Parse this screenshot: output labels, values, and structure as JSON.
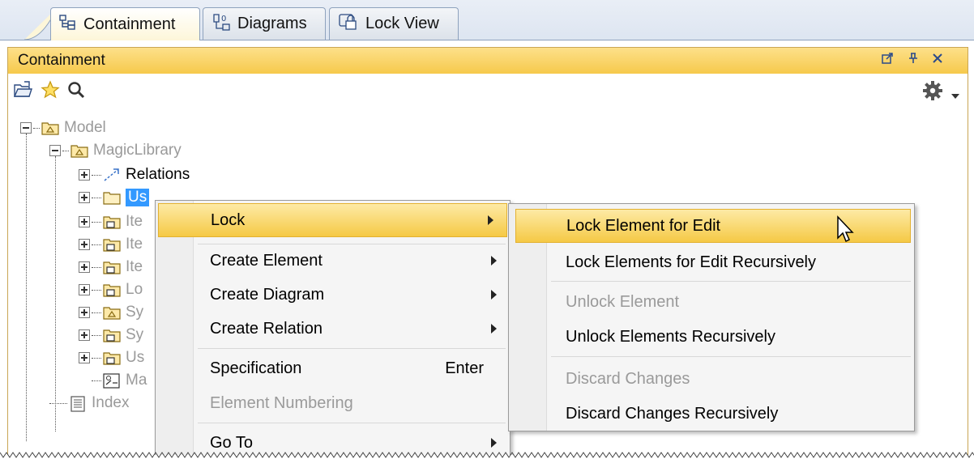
{
  "tabs": [
    {
      "label": "Containment",
      "icon": "containment-tree-icon",
      "active": true
    },
    {
      "label": "Diagrams",
      "icon": "diagrams-icon",
      "active": false
    },
    {
      "label": "Lock View",
      "icon": "lock-view-icon",
      "active": false
    }
  ],
  "panel": {
    "title": "Containment",
    "controls": [
      "float-icon",
      "pin-icon",
      "close-icon"
    ]
  },
  "toolbar": {
    "left_icons": [
      "open-folder-icon",
      "star-icon",
      "search-icon"
    ],
    "right_icons": [
      "gear-icon",
      "dropdown-arrow-icon"
    ]
  },
  "tree": {
    "model": "Model",
    "library": "MagicLibrary",
    "relations": "Relations",
    "selected": "Us",
    "truncated_children": [
      "Ite",
      "Ite",
      "Ite",
      "Lo",
      "Sy",
      "Sy",
      "Us",
      "Ma"
    ],
    "index": "Index"
  },
  "context_menu": {
    "items": [
      {
        "label": "Lock",
        "submenu": true,
        "highlighted": true
      },
      {
        "label": "Create Element",
        "submenu": true
      },
      {
        "label": "Create Diagram",
        "submenu": true
      },
      {
        "label": "Create Relation",
        "submenu": true
      },
      {
        "label": "Specification",
        "accelerator": "Enter"
      },
      {
        "label": "Element Numbering",
        "disabled": true
      },
      {
        "label": "Go To",
        "submenu": true
      }
    ]
  },
  "lock_submenu": {
    "items": [
      {
        "label": "Lock Element for Edit",
        "highlighted": true
      },
      {
        "label": "Lock Elements for Edit Recursively"
      },
      {
        "label": "Unlock Element",
        "disabled": true
      },
      {
        "label": "Unlock Elements Recursively"
      },
      {
        "label": "Discard Changes",
        "disabled": true
      },
      {
        "label": "Discard Changes Recursively"
      }
    ]
  },
  "colors": {
    "panel_title": "#f6c94b",
    "highlight": "#f5c945",
    "selection": "#3399ff",
    "disabled_text": "#9a9a9a"
  }
}
